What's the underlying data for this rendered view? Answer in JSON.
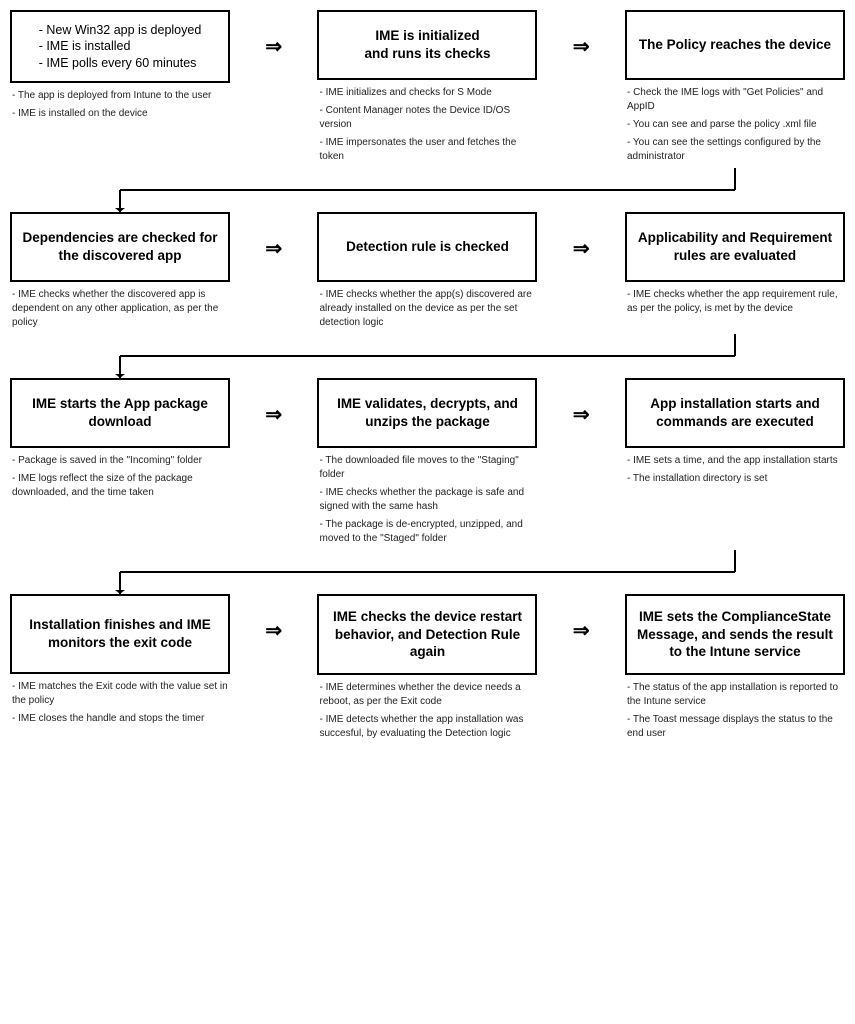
{
  "rows": [
    {
      "id": "row1",
      "boxes": [
        {
          "id": "box1",
          "title": "- New Win32 app is deployed\n- IME is installed\n- IME polls every 60 minutes",
          "bold": false,
          "notes": [
            "- The app is deployed from Intune to the user",
            "- IME is installed on the device"
          ]
        },
        {
          "id": "box2",
          "title": "IME is initialized and runs its checks",
          "bold": true,
          "notes": [
            "- IME initializes and checks for S Mode",
            "- Content Manager notes the Device ID/OS version",
            "- IME impersonates the user and fetches the token"
          ]
        },
        {
          "id": "box3",
          "title": "The Policy reaches the device",
          "bold": true,
          "notes": [
            "- Check the IME logs with \"Get Policies\" and AppID",
            "- You can see and parse the policy .xml file",
            "- You can see the settings configured by the administrator"
          ]
        }
      ]
    },
    {
      "id": "row2",
      "boxes": [
        {
          "id": "box4",
          "title": "Dependencies are checked for the discovered app",
          "bold": true,
          "notes": [
            "- IME checks whether the discovered app is dependent on any other application, as per the policy"
          ]
        },
        {
          "id": "box5",
          "title": "Detection rule is checked",
          "bold": true,
          "notes": [
            "- IME checks whether the app(s) discovered are already installed on the device as per the set detection logic"
          ]
        },
        {
          "id": "box6",
          "title": "Applicability and Requirement rules are evaluated",
          "bold": true,
          "notes": [
            "- IME checks whether the app requirement rule, as per the policy, is met by the device"
          ]
        }
      ]
    },
    {
      "id": "row3",
      "boxes": [
        {
          "id": "box7",
          "title": "IME starts the App package download",
          "bold": true,
          "notes": [
            "- Package is saved in the \"Incoming\" folder",
            "- IME logs reflect the size of the package downloaded, and the time taken"
          ]
        },
        {
          "id": "box8",
          "title": "IME validates, decrypts, and unzips the package",
          "bold": true,
          "notes": [
            "- The downloaded file moves to the \"Staging\" folder",
            "- IME checks whether the package is safe and signed with the same hash",
            "- The package is de-encrypted, unzipped, and moved to the \"Staged\" folder"
          ]
        },
        {
          "id": "box9",
          "title": "App installation starts and commands are executed",
          "bold": true,
          "notes": [
            "- IME sets a time, and the app installation starts",
            "- The installation directory is set"
          ]
        }
      ]
    },
    {
      "id": "row4",
      "boxes": [
        {
          "id": "box10",
          "title": "Installation finishes and IME monitors the exit code",
          "bold": true,
          "notes": [
            "- IME matches the Exit code with the value set in the policy",
            "- IME closes the handle and stops the timer"
          ]
        },
        {
          "id": "box11",
          "title": "IME checks the device restart behavior, and Detection Rule again",
          "bold": true,
          "notes": [
            "- IME determines whether the device needs a reboot, as per the Exit code",
            "- IME detects whether the app installation was succesful, by evaluating the Detection logic"
          ]
        },
        {
          "id": "box12",
          "title": "IME sets the ComplianceState Message, and sends the result to the Intune service",
          "bold": true,
          "notes": [
            "- The status of the app installation is reported to the Intune service",
            "- The Toast message displays the status to the end user"
          ]
        }
      ]
    }
  ],
  "arrows": {
    "right": "⇒",
    "down": "⇓"
  }
}
